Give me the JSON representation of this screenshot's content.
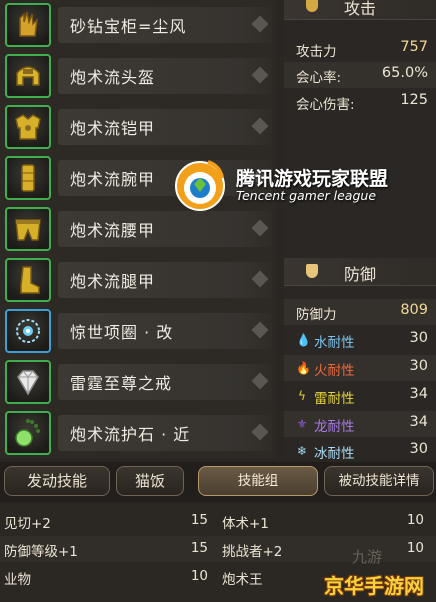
{
  "equipment": [
    {
      "name": "砂钻宝柜=尘风",
      "icon": "gauntlet-icon",
      "frame": "green"
    },
    {
      "name": "炮术流头盔",
      "icon": "helmet-icon",
      "frame": "green"
    },
    {
      "name": "炮术流铠甲",
      "icon": "armor-icon",
      "frame": "green"
    },
    {
      "name": "炮术流腕甲",
      "icon": "bracer-icon",
      "frame": "green"
    },
    {
      "name": "炮术流腰甲",
      "icon": "waist-icon",
      "frame": "green"
    },
    {
      "name": "炮术流腿甲",
      "icon": "greaves-icon",
      "frame": "green"
    },
    {
      "name": "惊世项圈 · 改",
      "icon": "necklace-icon",
      "frame": "blue"
    },
    {
      "name": "雷霆至尊之戒",
      "icon": "diamond-ring-icon",
      "frame": "green"
    },
    {
      "name": "炮术流护石 · 近",
      "icon": "charm-icon",
      "frame": "green"
    }
  ],
  "attack": {
    "title": "攻击",
    "stats": [
      {
        "label": "攻击力",
        "value": "757"
      },
      {
        "label": "会心率:",
        "value": "65.0%"
      },
      {
        "label": "会心伤害:",
        "value": "125"
      }
    ]
  },
  "defense": {
    "title": "防御",
    "power_label": "防御力",
    "power_value": "809",
    "resistances": [
      {
        "label": "水耐性",
        "value": "30",
        "icon": "water-drop-icon",
        "color": "#5fb6e8",
        "glyph": "💧"
      },
      {
        "label": "火耐性",
        "value": "30",
        "icon": "fire-icon",
        "color": "#e2552c",
        "glyph": "🔥"
      },
      {
        "label": "雷耐性",
        "value": "34",
        "icon": "thunder-icon",
        "color": "#e6d33a",
        "glyph": "ϟ"
      },
      {
        "label": "龙耐性",
        "value": "34",
        "icon": "dragon-icon",
        "color": "#8e5fd8",
        "glyph": "⚜"
      },
      {
        "label": "冰耐性",
        "value": "30",
        "icon": "ice-icon",
        "color": "#9fd6f2",
        "glyph": "❄"
      }
    ]
  },
  "watermark": {
    "title": "腾讯游戏玩家联盟",
    "subtitle": "Tencent gamer league"
  },
  "tabs": [
    {
      "label": "发动技能",
      "active": false
    },
    {
      "label": "猫饭",
      "active": false
    },
    {
      "label": "技能组",
      "active": true
    },
    {
      "label": "被动技能详情",
      "active": false
    }
  ],
  "skills": [
    {
      "left_name": "见切+2",
      "left_value": "15",
      "right_name": "体术+1",
      "right_value": "10"
    },
    {
      "left_name": "防御等级+1",
      "left_value": "15",
      "right_name": "挑战者+2",
      "right_value": "10"
    },
    {
      "left_name": "业物",
      "left_value": "10",
      "right_name": "炮术王",
      "right_value": ""
    }
  ],
  "corner_logo": "京华手游网",
  "corner_faint": "九游"
}
